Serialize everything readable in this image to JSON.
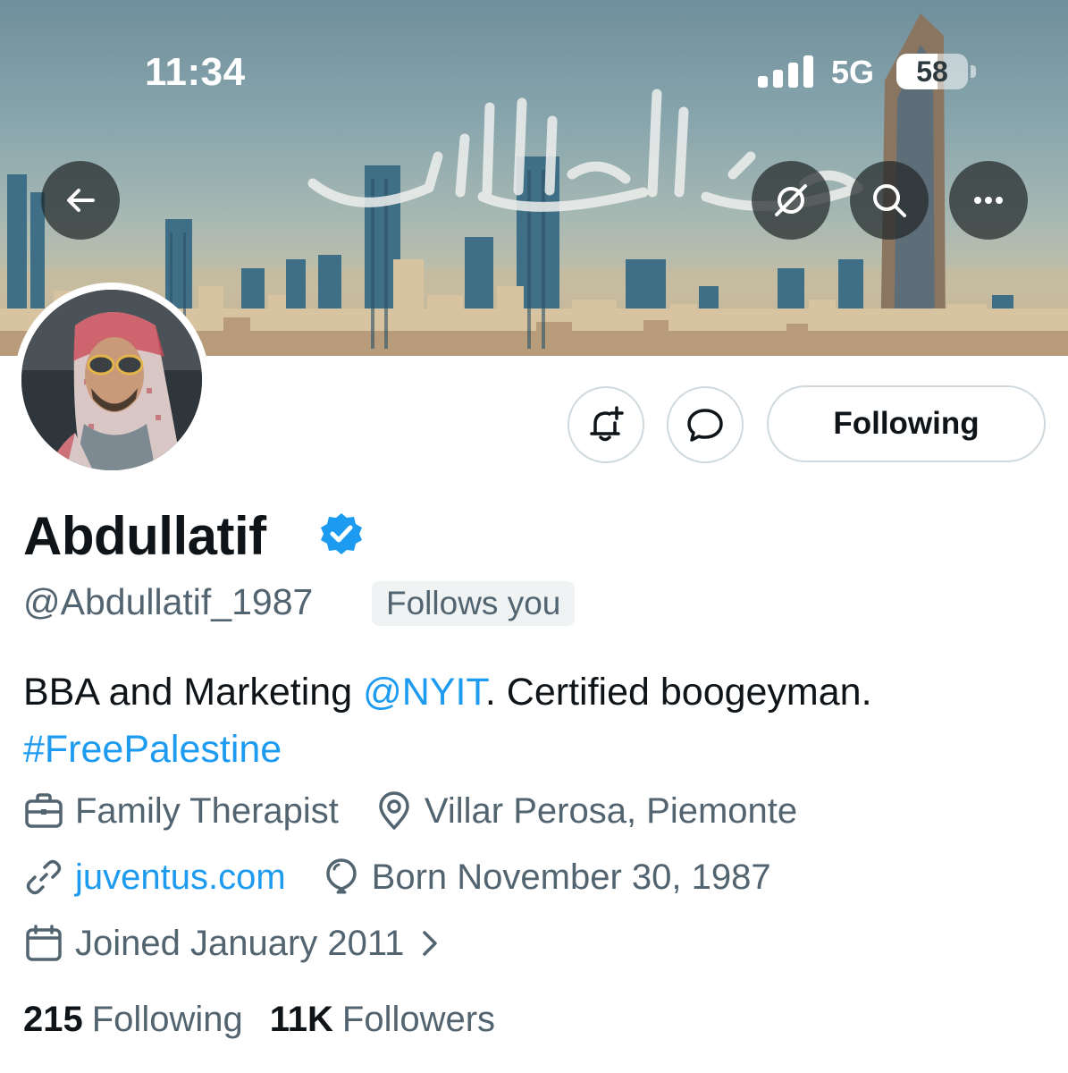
{
  "status_bar": {
    "time": "11:34",
    "network": "5G",
    "battery_percent": 58,
    "battery_label": "58"
  },
  "banner": {
    "calligraphy_icon": "arabic-calligraphy-name",
    "nav": {
      "back_icon": "arrow-left-icon",
      "grok_icon": "grok-slash-icon",
      "search_icon": "search-icon",
      "more_icon": "more-dots-icon"
    }
  },
  "actions": {
    "notify_icon": "bell-plus-icon",
    "message_icon": "message-bubble-icon",
    "following_label": "Following"
  },
  "profile": {
    "display_name": "Abdullatif",
    "verified": true,
    "handle": "@Abdullatif_1987",
    "follows_you": "Follows you",
    "bio": {
      "part1": "BBA and Marketing ",
      "mention": "@NYIT",
      "part2": ". Certified boogeyman.",
      "hashtag": "#FreePalestine"
    },
    "profession": "Family Therapist",
    "location": "Villar Perosa, Piemonte",
    "website": "juventus.com",
    "birthday": "Born November 30, 1987",
    "joined": "Joined January 2011",
    "following_count": "215",
    "following_label": "Following",
    "followers_count": "11K",
    "followers_label": "Followers"
  },
  "colors": {
    "accent": "#1d9bf0",
    "secondary_text": "#536471",
    "primary_text": "#0f1419",
    "border": "#cfd9de"
  }
}
